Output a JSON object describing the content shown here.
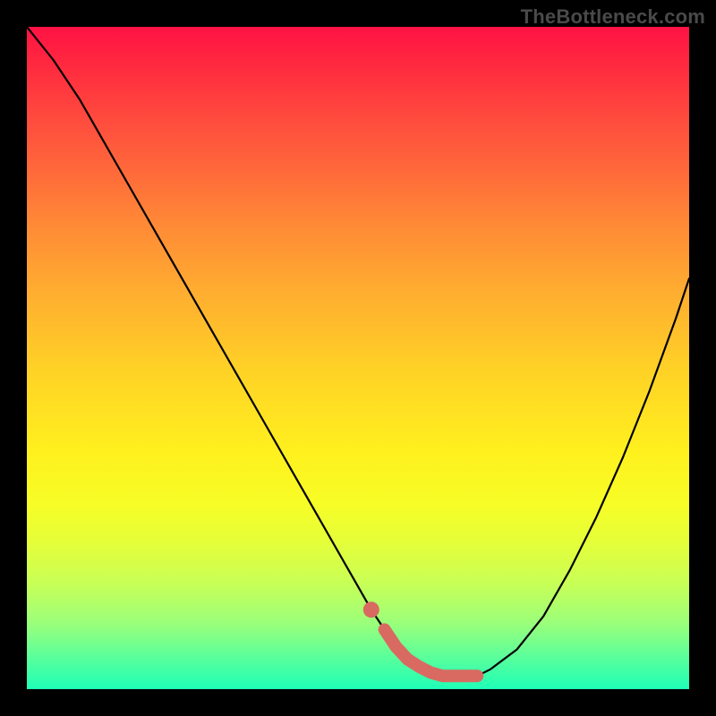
{
  "watermark": "TheBottleneck.com",
  "chart_data": {
    "type": "line",
    "title": "",
    "xlabel": "",
    "ylabel": "",
    "xlim": [
      0,
      100
    ],
    "ylim": [
      0,
      100
    ],
    "grid": false,
    "background": "red-yellow-green vertical gradient",
    "series": [
      {
        "name": "curve",
        "color": "#000000",
        "x": [
          0,
          4,
          8,
          12,
          16,
          20,
          24,
          28,
          32,
          36,
          40,
          44,
          48,
          52,
          54,
          56,
          58,
          60,
          62,
          64,
          66,
          68,
          70,
          74,
          78,
          82,
          86,
          90,
          94,
          98,
          100
        ],
        "y": [
          100,
          95,
          89,
          82,
          75,
          68,
          61,
          54,
          47,
          40,
          33,
          26,
          19,
          12,
          9,
          6,
          4,
          3,
          2,
          2,
          2,
          2,
          3,
          6,
          11,
          18,
          26,
          35,
          45,
          56,
          62
        ]
      }
    ],
    "annotations": [
      {
        "name": "optimal-range-marker",
        "color": "#d96a62",
        "x_range": [
          54,
          68
        ],
        "y": 2,
        "note": "thick rounded segment near curve minimum with leading dot"
      }
    ]
  }
}
